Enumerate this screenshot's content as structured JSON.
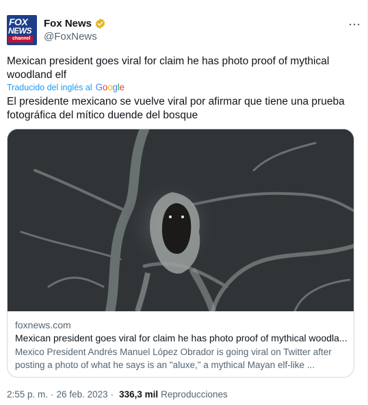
{
  "author": {
    "name": "Fox News",
    "handle": "@FoxNews",
    "avatar_text_top": "FOX",
    "avatar_text_mid": "NEWS",
    "avatar_text_bottom": "channel"
  },
  "more_label": "···",
  "tweet": {
    "text_en": "Mexican president goes viral for claim he has photo proof of mythical woodland elf",
    "translated_label": "Traducido del inglés al",
    "translation_provider": "Google",
    "text_es": "El presidente mexicano se vuelve viral por afirmar que tiene una prueba fotográfica del mítico duende del bosque"
  },
  "card": {
    "domain": "foxnews.com",
    "title": "Mexican president goes viral for claim he has photo proof of mythical woodla...",
    "description": "Mexico President Andrés Manuel López Obrador is going viral on Twitter after posting a photo of what he says is an \"aluxe,\" a mythical Mayan elf-like ..."
  },
  "meta": {
    "time": "2:55 p. m.",
    "separator": "·",
    "date": "26 feb. 2023",
    "views": "336,3 mil",
    "views_label": "Reproducciones"
  },
  "colors": {
    "accent": "#1d9bf0",
    "secondary_text": "#536471",
    "verified_gold": "#e2b719"
  }
}
